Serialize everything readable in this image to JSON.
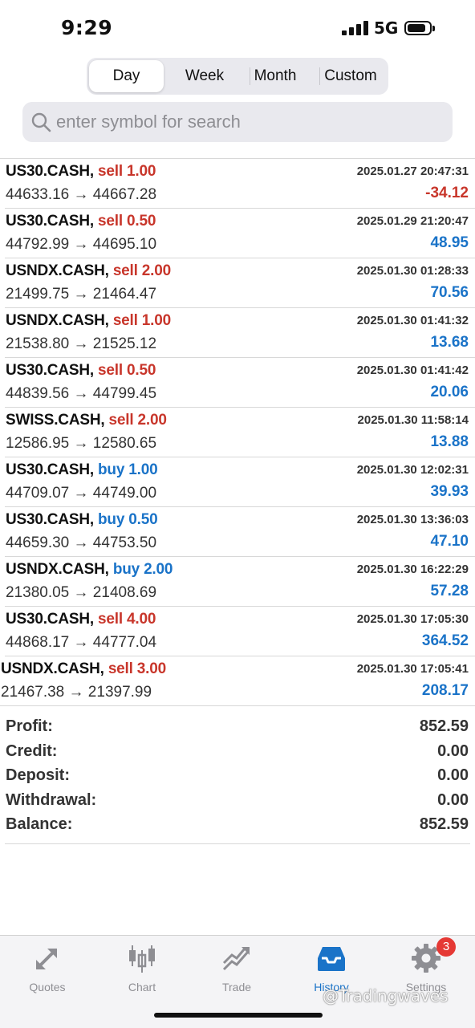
{
  "status_bar": {
    "time": "9:29",
    "network": "5G"
  },
  "period_tabs": [
    {
      "label": "Day",
      "active": true
    },
    {
      "label": "Week",
      "active": false
    },
    {
      "label": "Month",
      "active": false
    },
    {
      "label": "Custom",
      "active": false
    }
  ],
  "search": {
    "placeholder": "enter symbol for search",
    "value": ""
  },
  "deals": [
    {
      "symbol": "US30.CASH,",
      "side": "sell 1.00",
      "type": "sell",
      "time": "2025.01.27 20:47:31",
      "prices": "44633.16 → 44667.28",
      "profit": "-34.12"
    },
    {
      "symbol": "US30.CASH,",
      "side": "sell 0.50",
      "type": "sell",
      "time": "2025.01.29 21:20:47",
      "prices": "44792.99 → 44695.10",
      "profit": "48.95"
    },
    {
      "symbol": "USNDX.CASH,",
      "side": "sell 2.00",
      "type": "sell",
      "time": "2025.01.30 01:28:33",
      "prices": "21499.75 → 21464.47",
      "profit": "70.56"
    },
    {
      "symbol": "USNDX.CASH,",
      "side": "sell 1.00",
      "type": "sell",
      "time": "2025.01.30 01:41:32",
      "prices": "21538.80 → 21525.12",
      "profit": "13.68"
    },
    {
      "symbol": "US30.CASH,",
      "side": "sell 0.50",
      "type": "sell",
      "time": "2025.01.30 01:41:42",
      "prices": "44839.56 → 44799.45",
      "profit": "20.06"
    },
    {
      "symbol": "SWISS.CASH,",
      "side": "sell 2.00",
      "type": "sell",
      "time": "2025.01.30 11:58:14",
      "prices": "12586.95 → 12580.65",
      "profit": "13.88"
    },
    {
      "symbol": "US30.CASH,",
      "side": "buy 1.00",
      "type": "buy",
      "time": "2025.01.30 12:02:31",
      "prices": "44709.07 → 44749.00",
      "profit": "39.93"
    },
    {
      "symbol": "US30.CASH,",
      "side": "buy 0.50",
      "type": "buy",
      "time": "2025.01.30 13:36:03",
      "prices": "44659.30 → 44753.50",
      "profit": "47.10"
    },
    {
      "symbol": "USNDX.CASH,",
      "side": "buy 2.00",
      "type": "buy",
      "time": "2025.01.30 16:22:29",
      "prices": "21380.05 → 21408.69",
      "profit": "57.28"
    },
    {
      "symbol": "US30.CASH,",
      "side": "sell 4.00",
      "type": "sell",
      "time": "2025.01.30 17:05:30",
      "prices": "44868.17 → 44777.04",
      "profit": "364.52"
    },
    {
      "symbol": "USNDX.CASH,",
      "side": "sell 3.00",
      "type": "sell",
      "time": "2025.01.30 17:05:41",
      "prices": "21467.38 → 21397.99",
      "profit": "208.17"
    }
  ],
  "summary": [
    {
      "label": "Profit:",
      "value": "852.59"
    },
    {
      "label": "Credit:",
      "value": "0.00"
    },
    {
      "label": "Deposit:",
      "value": "0.00"
    },
    {
      "label": "Withdrawal:",
      "value": "0.00"
    },
    {
      "label": "Balance:",
      "value": "852.59"
    }
  ],
  "tab_bar": [
    {
      "label": "Quotes",
      "icon": "quotes-icon",
      "active": false
    },
    {
      "label": "Chart",
      "icon": "chart-icon",
      "active": false
    },
    {
      "label": "Trade",
      "icon": "trade-icon",
      "active": false
    },
    {
      "label": "History",
      "icon": "history-icon",
      "active": true
    },
    {
      "label": "Settings",
      "icon": "settings-icon",
      "active": false,
      "badge": "3"
    }
  ],
  "watermark": "@Tradingwaves",
  "colors": {
    "sell": "#c8362b",
    "buy": "#1a73c8",
    "active_tab": "#1a73c8",
    "inactive_tab": "#8e8e93"
  }
}
